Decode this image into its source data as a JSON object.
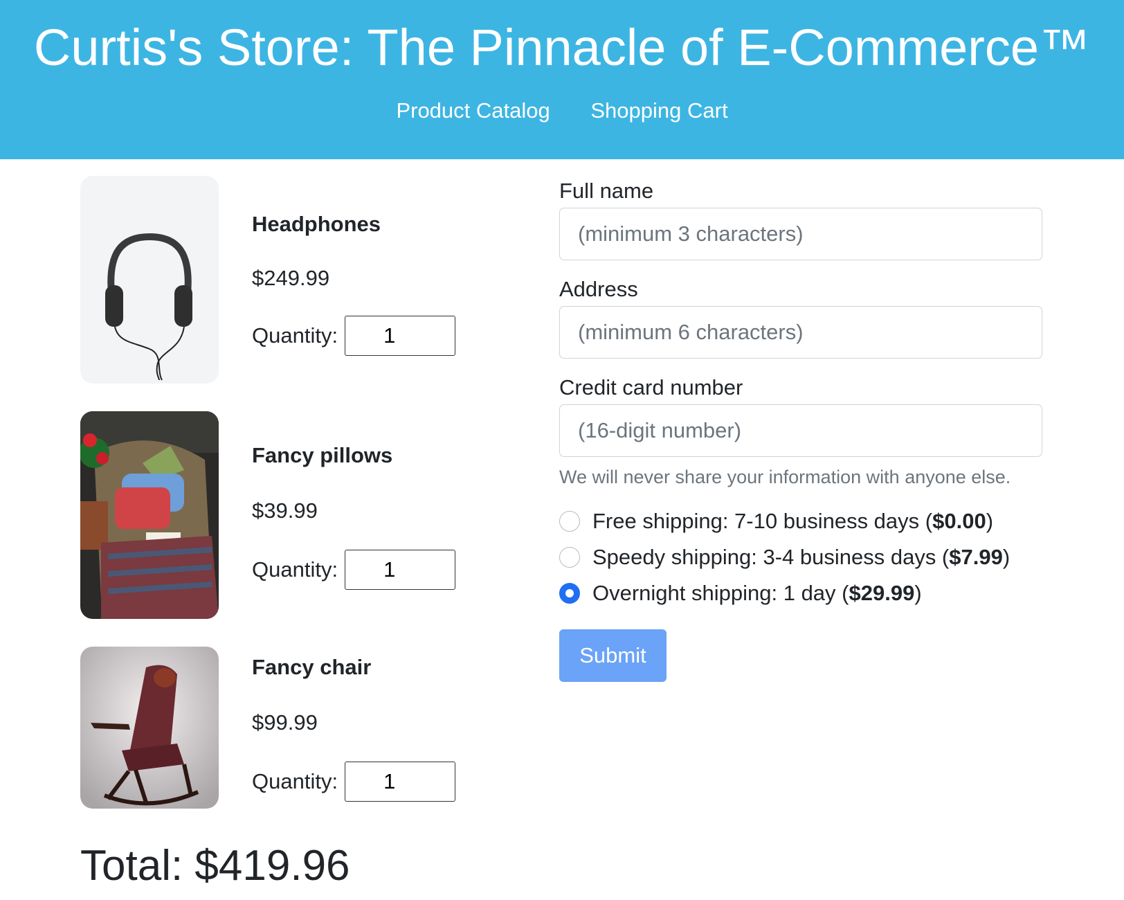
{
  "header": {
    "title": "Curtis's Store: The Pinnacle of E-Commerce™",
    "nav": [
      "Product Catalog",
      "Shopping Cart"
    ]
  },
  "cart": {
    "items": [
      {
        "name": "Headphones",
        "price": "$249.99",
        "quantity_label": "Quantity:",
        "quantity": "1",
        "image_icon": "headphones-image"
      },
      {
        "name": "Fancy pillows",
        "price": "$39.99",
        "quantity_label": "Quantity:",
        "quantity": "1",
        "image_icon": "pillows-image"
      },
      {
        "name": "Fancy chair",
        "price": "$99.99",
        "quantity_label": "Quantity:",
        "quantity": "1",
        "image_icon": "chair-image"
      }
    ],
    "total": "Total: $419.96"
  },
  "form": {
    "full_name_label": "Full name",
    "full_name_placeholder": "(minimum 3 characters)",
    "address_label": "Address",
    "address_placeholder": "(minimum 6 characters)",
    "card_label": "Credit card number",
    "card_placeholder": "(16-digit number)",
    "hint": "We will never share your information with anyone else.",
    "shipping": [
      {
        "text": "Free shipping: 7-10 business days (",
        "price": "$0.00",
        "close": ")",
        "checked": false
      },
      {
        "text": "Speedy shipping: 3-4 business days (",
        "price": "$7.99",
        "close": ")",
        "checked": false
      },
      {
        "text": "Overnight shipping: 1 day (",
        "price": "$29.99",
        "close": ")",
        "checked": true
      }
    ],
    "submit_label": "Submit"
  },
  "colors": {
    "header_bg": "#3db5e3",
    "radio_checked": "#1f6ff5",
    "submit_bg": "#6aa3f7"
  }
}
